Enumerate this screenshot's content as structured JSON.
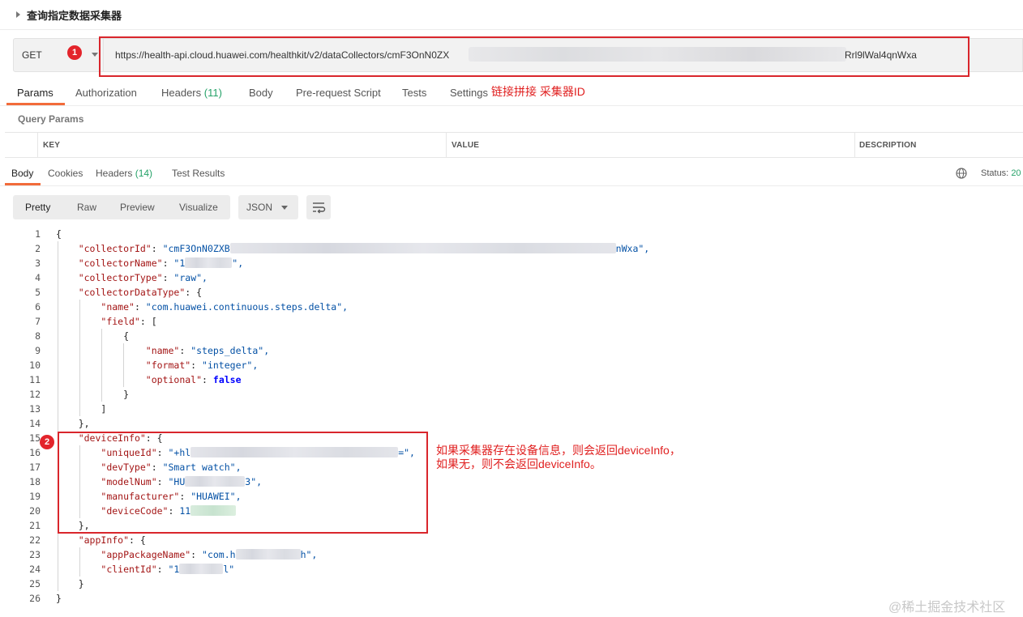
{
  "request": {
    "title": "查询指定数据采集器",
    "method": "GET",
    "url_prefix": "https://health-api.cloud.huawei.com/healthkit/v2/dataCollectors/cmF3OnN0ZX",
    "url_suffix": "Rrl9lWal4qnWxa",
    "badge_1": "1",
    "annotation_1": "链接拼接 采集器ID"
  },
  "request_tabs": [
    {
      "label": "Params",
      "count": ""
    },
    {
      "label": "Authorization",
      "count": ""
    },
    {
      "label": "Headers",
      "count": "(11)"
    },
    {
      "label": "Body",
      "count": ""
    },
    {
      "label": "Pre-request Script",
      "count": ""
    },
    {
      "label": "Tests",
      "count": ""
    },
    {
      "label": "Settings",
      "count": ""
    }
  ],
  "query_params": {
    "title": "Query Params",
    "headers": [
      "KEY",
      "VALUE",
      "DESCRIPTION"
    ]
  },
  "response_tabs": [
    {
      "label": "Body",
      "count": ""
    },
    {
      "label": "Cookies",
      "count": ""
    },
    {
      "label": "Headers",
      "count": "(14)"
    },
    {
      "label": "Test Results",
      "count": ""
    }
  ],
  "status": {
    "label": "Status:",
    "value": "20"
  },
  "view_modes": [
    "Pretty",
    "Raw",
    "Preview",
    "Visualize"
  ],
  "format": "JSON",
  "code": {
    "line_numbers": [
      "1",
      "2",
      "3",
      "4",
      "5",
      "6",
      "7",
      "8",
      "9",
      "10",
      "11",
      "12",
      "13",
      "14",
      "15",
      "16",
      "17",
      "18",
      "19",
      "20",
      "21",
      "22",
      "23",
      "24",
      "25",
      "26"
    ],
    "collector_id_start": "\"cmF3OnN0ZXB",
    "collector_id_end": "nWxa\",",
    "collector_name_start": "\"1",
    "collector_type": "\"raw\",",
    "data_type_name": "\"com.huawei.continuous.steps.delta\",",
    "field_name": "\"steps_delta\",",
    "field_format": "\"integer\",",
    "field_optional": "false",
    "unique_id_start": "\"+hl",
    "unique_id_end": "=\",",
    "dev_type": "\"Smart watch\",",
    "model_num_start": "\"HU",
    "model_num_end": "3\",",
    "manufacturer": "\"HUAWEI\",",
    "device_code_start": "11",
    "app_package_start": "\"com.h",
    "app_package_end": "h\",",
    "client_id_start": "\"1",
    "client_id_end": "l\""
  },
  "badge_2": "2",
  "annotation_2_line1": "如果采集器存在设备信息，则会返回deviceInfo，",
  "annotation_2_line2": "如果无，则不会返回deviceInfo。",
  "watermark": "@稀土掘金技术社区"
}
